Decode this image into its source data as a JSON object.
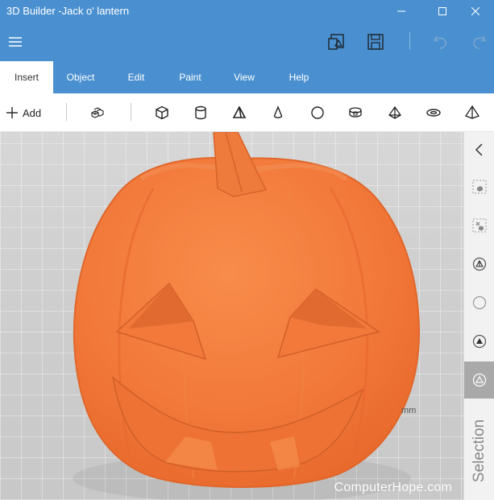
{
  "window": {
    "title": "3D Builder -Jack o' lantern"
  },
  "appbar": {
    "icons": [
      "menu-icon",
      "3d-print-icon",
      "save-icon",
      "undo-icon",
      "redo-icon"
    ]
  },
  "tabs": [
    {
      "label": "Insert",
      "active": true
    },
    {
      "label": "Object",
      "active": false
    },
    {
      "label": "Edit",
      "active": false
    },
    {
      "label": "Paint",
      "active": false
    },
    {
      "label": "View",
      "active": false
    },
    {
      "label": "Help",
      "active": false
    }
  ],
  "toolbar": {
    "add_label": "Add",
    "tools": [
      "cube-group",
      "cube",
      "cylinder",
      "tetrahedron",
      "cone",
      "sphere",
      "torus-box",
      "pyramid",
      "torus",
      "octahedron"
    ]
  },
  "viewport": {
    "scale_label": "mm",
    "watermark": "ComputerHope.com",
    "pumpkin_color": "#f2793a"
  },
  "sidepanel": {
    "selection_label": "Selection",
    "icons": [
      "collapse-icon",
      "select-object-icon",
      "select-object-x-icon",
      "select-mesh-icon",
      "select-sphere-icon",
      "select-face-icon",
      "select-triangle-icon"
    ]
  },
  "colors": {
    "accent": "#4a90d0",
    "toolbar_bg": "#ffffff",
    "side_bg": "#f2f2f2"
  }
}
